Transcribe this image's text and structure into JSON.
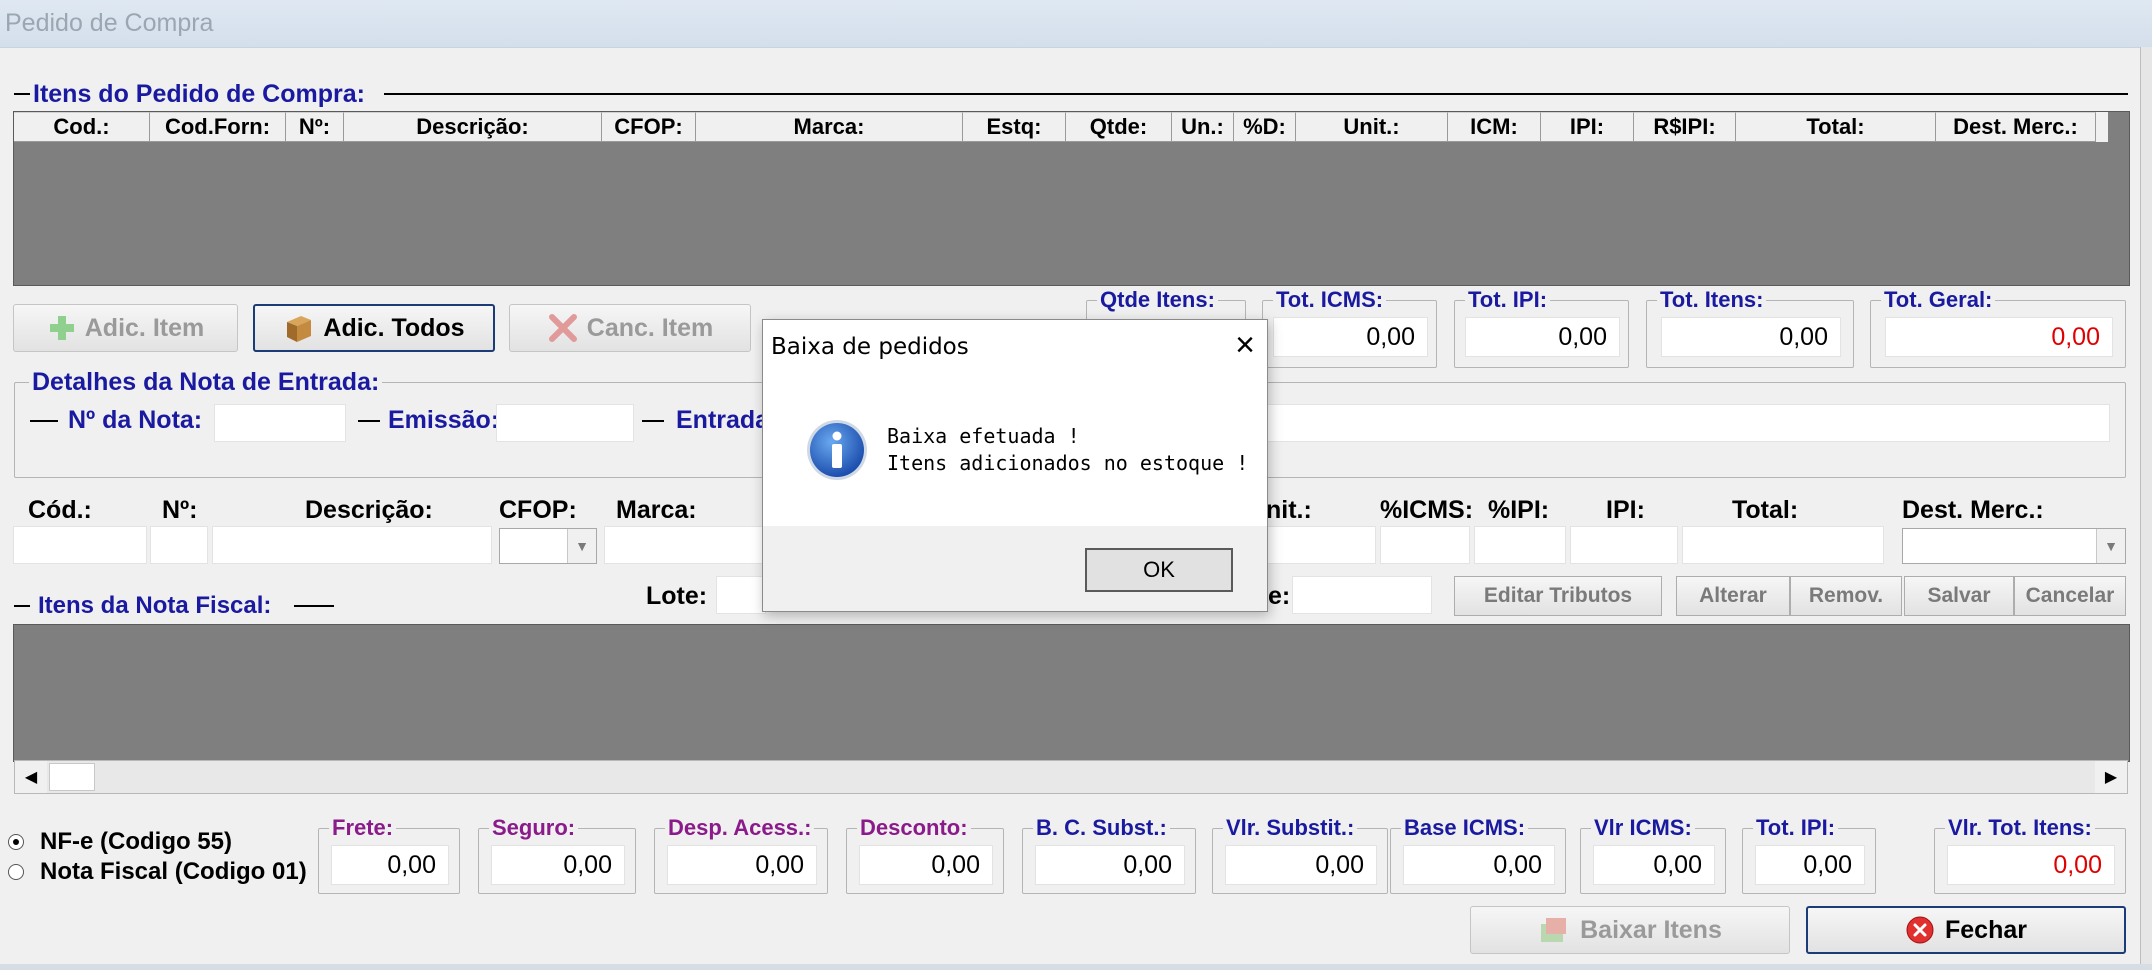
{
  "window": {
    "title": "Pedido de Compra"
  },
  "pedido": {
    "section_title": "Itens do Pedido de Compra:",
    "columns": [
      "Cod.:",
      "Cod.Forn:",
      "Nº:",
      "Descrição:",
      "CFOP:",
      "Marca:",
      "Estq:",
      "Qtde:",
      "Un.:",
      "%D:",
      "Unit.:",
      "ICM:",
      "IPI:",
      "R$IPI:",
      "Total:",
      "Dest. Merc.:"
    ]
  },
  "buttons": {
    "adic_item": "Adic. Item",
    "adic_todos": "Adic. Todos",
    "canc_item": "Canc. Item",
    "editar_tributos": "Editar Tributos",
    "alterar": "Alterar",
    "remov": "Remov.",
    "salvar": "Salvar",
    "cancelar": "Cancelar",
    "baixar_itens": "Baixar Itens",
    "fechar": "Fechar"
  },
  "totals": {
    "qtde_itens_label": "Qtde Itens:",
    "tot_icms_label": "Tot. ICMS:",
    "tot_icms_value": "0,00",
    "tot_ipi_label": "Tot. IPI:",
    "tot_ipi_value": "0,00",
    "tot_itens_label": "Tot. Itens:",
    "tot_itens_value": "0,00",
    "tot_geral_label": "Tot. Geral:",
    "tot_geral_value": "0,00"
  },
  "detalhes": {
    "section_title": "Detalhes da Nota de Entrada:",
    "nro_nota_label": "Nº da Nota:",
    "emissao_label": "Emissão:",
    "entrada_label": "Entrada"
  },
  "item_form": {
    "cod_label": "Cód.:",
    "nro_label": "Nº:",
    "descricao_label": "Descrição:",
    "cfop_label": "CFOP:",
    "marca_label": "Marca:",
    "unit_label": "nit.:",
    "icms_label": "%ICMS:",
    "ipi_pct_label": "%IPI:",
    "ipi_label": "IPI:",
    "total_label": "Total:",
    "dest_label": "Dest. Merc.:",
    "lote_label": "Lote:",
    "e_label": "e:"
  },
  "nota": {
    "section_title": "Itens da Nota Fiscal:"
  },
  "tipo_nota": {
    "options": [
      "NF-e (Codigo 55)",
      "Nota Fiscal (Codigo 01)"
    ],
    "selected": "NF-e (Codigo 55)"
  },
  "footer_totals": {
    "frete_label": "Frete:",
    "frete_value": "0,00",
    "seguro_label": "Seguro:",
    "seguro_value": "0,00",
    "desp_label": "Desp. Acess.:",
    "desp_value": "0,00",
    "desconto_label": "Desconto:",
    "desconto_value": "0,00",
    "bc_subst_label": "B. C. Subst.:",
    "bc_subst_value": "0,00",
    "vlr_subst_label": "Vlr. Substit.:",
    "vlr_subst_value": "0,00",
    "base_icms_label": "Base ICMS:",
    "base_icms_value": "0,00",
    "vlr_icms_label": "Vlr ICMS:",
    "vlr_icms_value": "0,00",
    "tot_ipi_label": "Tot. IPI:",
    "tot_ipi_value": "0,00",
    "vlr_tot_itens_label": "Vlr. Tot. Itens:",
    "vlr_tot_itens_value": "0,00"
  },
  "dialog": {
    "title": "Baixa de pedidos",
    "line1": "Baixa efetuada !",
    "line2": "Itens adicionados no estoque !",
    "ok": "OK"
  },
  "colors": {
    "navy": "#1a1aa0",
    "purple": "#8b1a8b",
    "green": "#1ea01e",
    "red": "#e00000",
    "grid": "#7f7f7f"
  }
}
